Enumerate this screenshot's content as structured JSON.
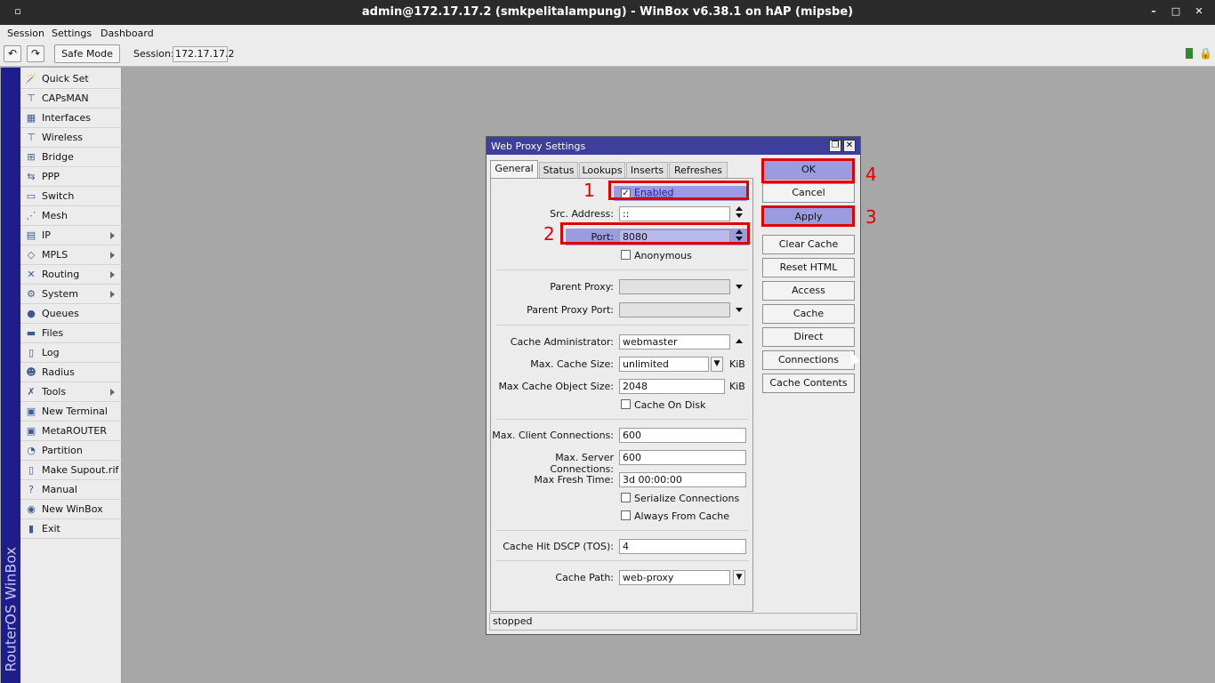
{
  "window": {
    "title": "admin@172.17.17.2 (smkpelitalampung) - WinBox v6.38.1 on hAP (mipsbe)",
    "controls": [
      "▫",
      "–",
      "□",
      "✕"
    ]
  },
  "menubar": {
    "items": [
      "Session",
      "Settings",
      "Dashboard"
    ]
  },
  "toolbar": {
    "undo_icon": "undo-icon",
    "redo_icon": "redo-icon",
    "safe_mode": "Safe Mode",
    "session_label": "Session:",
    "session_value": "172.17.17.2"
  },
  "strip": {
    "text": "RouterOS WinBox"
  },
  "sidebar": {
    "items": [
      {
        "label": "Quick Set",
        "icon": "🪄"
      },
      {
        "label": "CAPsMAN",
        "icon": "⊤"
      },
      {
        "label": "Interfaces",
        "icon": "▦"
      },
      {
        "label": "Wireless",
        "icon": "⊤"
      },
      {
        "label": "Bridge",
        "icon": "⊞"
      },
      {
        "label": "PPP",
        "icon": "⇆"
      },
      {
        "label": "Switch",
        "icon": "▭"
      },
      {
        "label": "Mesh",
        "icon": "⋰"
      },
      {
        "label": "IP",
        "icon": "▤"
      },
      {
        "label": "MPLS",
        "icon": "◇"
      },
      {
        "label": "Routing",
        "icon": "✕"
      },
      {
        "label": "System",
        "icon": "⚙"
      },
      {
        "label": "Queues",
        "icon": "●"
      },
      {
        "label": "Files",
        "icon": "▬"
      },
      {
        "label": "Log",
        "icon": "▯"
      },
      {
        "label": "Radius",
        "icon": "☻"
      },
      {
        "label": "Tools",
        "icon": "✗"
      },
      {
        "label": "New Terminal",
        "icon": "▣"
      },
      {
        "label": "MetaROUTER",
        "icon": "▣"
      },
      {
        "label": "Partition",
        "icon": "◔"
      },
      {
        "label": "Make Supout.rif",
        "icon": "▯"
      },
      {
        "label": "Manual",
        "icon": "?"
      },
      {
        "label": "New WinBox",
        "icon": "◉"
      },
      {
        "label": "Exit",
        "icon": "▮"
      }
    ]
  },
  "dialog": {
    "title": "Web Proxy Settings",
    "restore_icon": "restore-icon",
    "close_icon": "close-icon",
    "tabs": [
      "General",
      "Status",
      "Lookups",
      "Inserts",
      "Refreshes"
    ],
    "fields": {
      "enabled": {
        "label": "Enabled",
        "checked": true
      },
      "src_address": {
        "label": "Src. Address:",
        "value": "::"
      },
      "port": {
        "label": "Port:",
        "value": "8080"
      },
      "anonymous": {
        "label": "Anonymous",
        "checked": false
      },
      "parent_proxy": {
        "label": "Parent Proxy:",
        "value": ""
      },
      "parent_proxy_port": {
        "label": "Parent Proxy Port:",
        "value": ""
      },
      "cache_admin": {
        "label": "Cache Administrator:",
        "value": "webmaster"
      },
      "max_cache_size": {
        "label": "Max. Cache Size:",
        "value": "unlimited",
        "unit": "KiB"
      },
      "max_cache_object_size": {
        "label": "Max Cache Object Size:",
        "value": "2048",
        "unit": "KiB"
      },
      "cache_on_disk": {
        "label": "Cache On Disk",
        "checked": false
      },
      "max_client_conn": {
        "label": "Max. Client Connections:",
        "value": "600"
      },
      "max_server_conn": {
        "label": "Max. Server Connections:",
        "value": "600"
      },
      "max_fresh_time": {
        "label": "Max Fresh Time:",
        "value": "3d 00:00:00"
      },
      "serialize_conn": {
        "label": "Serialize Connections",
        "checked": false
      },
      "always_from_cache": {
        "label": "Always From Cache",
        "checked": false
      },
      "cache_hit_dscp": {
        "label": "Cache Hit DSCP (TOS):",
        "value": "4"
      },
      "cache_path": {
        "label": "Cache Path:",
        "value": "web-proxy"
      }
    },
    "buttons": [
      "OK",
      "Cancel",
      "Apply",
      "Clear Cache",
      "Reset HTML",
      "Access",
      "Cache",
      "Direct",
      "Connections",
      "Cache Contents"
    ],
    "status": "stopped"
  },
  "annotations": [
    "1",
    "2",
    "3",
    "4"
  ],
  "colors": {
    "annotation": "#e00000",
    "dialog_title": "#3e3e9d",
    "highlight": "#9b9be0",
    "strip": "#1d1d8c"
  }
}
